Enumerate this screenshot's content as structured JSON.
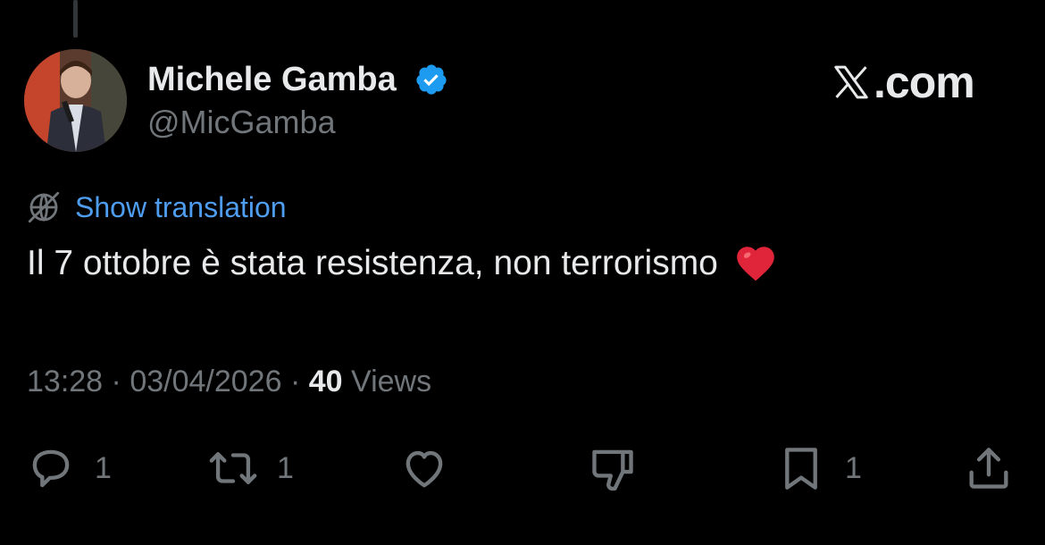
{
  "tweet": {
    "author": {
      "display_name": "Michele Gamba",
      "handle": "@MicGamba",
      "verified": true
    },
    "brand": {
      "dotcom": ".com"
    },
    "translate_label": "Show translation",
    "text": "Il 7 ottobre è stata resistenza, non terrorismo",
    "emoji": "red-heart",
    "meta": {
      "time": "13:28",
      "separator": "·",
      "date": "03/04/2026",
      "views_count": "40",
      "views_label": "Views"
    },
    "actions": {
      "reply_count": "1",
      "repost_count": "1",
      "bookmark_count": "1"
    }
  },
  "colors": {
    "background": "#000000",
    "primary_text": "#e7e9ea",
    "secondary_text": "#71767b",
    "link": "#4f9df1",
    "verified": "#1d9bf0",
    "heart": "#e0243a"
  },
  "icons": [
    "verified-badge-icon",
    "x-logo-icon",
    "globe-icon",
    "reply-icon",
    "repost-icon",
    "like-icon",
    "dislike-icon",
    "bookmark-icon",
    "share-icon"
  ]
}
